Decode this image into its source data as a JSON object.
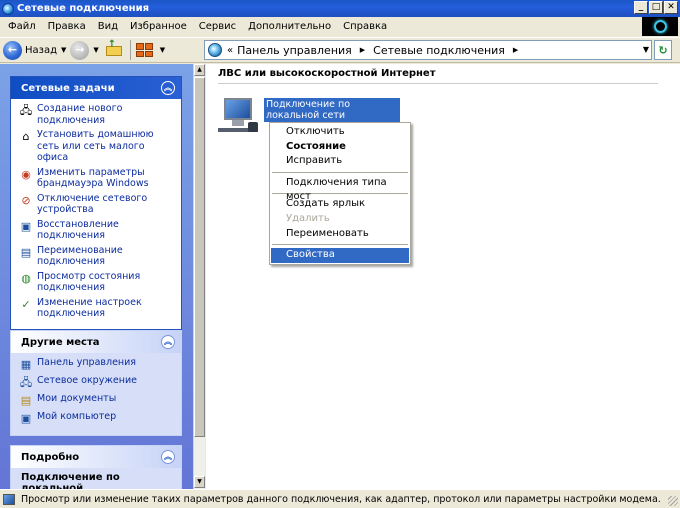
{
  "window": {
    "title": "Сетевые подключения"
  },
  "menu": [
    "Файл",
    "Правка",
    "Вид",
    "Избранное",
    "Сервис",
    "Дополнительно",
    "Справка"
  ],
  "toolbar": {
    "back_label": "Назад"
  },
  "address": {
    "crumbs": [
      "Панель управления",
      "Сетевые подключения"
    ]
  },
  "tasks_panel": {
    "title": "Сетевые задачи",
    "items": [
      {
        "label": "Создание нового подключения",
        "icon": "new-connection-icon"
      },
      {
        "label": "Установить домашнюю сеть или сеть малого офиса",
        "icon": "home-network-icon"
      },
      {
        "label": "Изменить параметры брандмауэра Windows",
        "icon": "firewall-icon"
      },
      {
        "label": "Отключение сетевого устройства",
        "icon": "disable-device-icon"
      },
      {
        "label": "Восстановление подключения",
        "icon": "repair-icon"
      },
      {
        "label": "Переименование подключения",
        "icon": "rename-icon"
      },
      {
        "label": "Просмотр состояния подключения",
        "icon": "status-icon"
      },
      {
        "label": "Изменение настроек подключения",
        "icon": "settings-icon"
      }
    ]
  },
  "places_panel": {
    "title": "Другие места",
    "items": [
      {
        "label": "Панель управления",
        "icon": "control-panel-icon"
      },
      {
        "label": "Сетевое окружение",
        "icon": "network-places-icon"
      },
      {
        "label": "Мои документы",
        "icon": "my-documents-icon"
      },
      {
        "label": "Мой компьютер",
        "icon": "my-computer-icon"
      }
    ]
  },
  "details_panel": {
    "title": "Подробно",
    "text": "Подключение по локальной"
  },
  "main": {
    "group_title": "ЛВС или высокоскоростной Интернет",
    "connection_label": "Подключение по локальной сети"
  },
  "context_menu": {
    "items": [
      {
        "label": "Отключить",
        "state": "normal"
      },
      {
        "label": "Состояние",
        "state": "bold"
      },
      {
        "label": "Исправить",
        "state": "normal"
      },
      {
        "separator": true
      },
      {
        "label": "Подключения типа мост",
        "state": "normal"
      },
      {
        "separator": true
      },
      {
        "label": "Создать ярлык",
        "state": "normal"
      },
      {
        "label": "Удалить",
        "state": "disabled"
      },
      {
        "label": "Переименовать",
        "state": "normal"
      },
      {
        "separator": true
      },
      {
        "label": "Свойства",
        "state": "selected"
      }
    ]
  },
  "status": {
    "text": "Просмотр или изменение таких параметров данного подключения, как адаптер, протокол или параметры настройки модема."
  },
  "colors": {
    "selection": "#316ac5",
    "titlebar": "#245edb",
    "panel_header": "#0f4dc3"
  }
}
